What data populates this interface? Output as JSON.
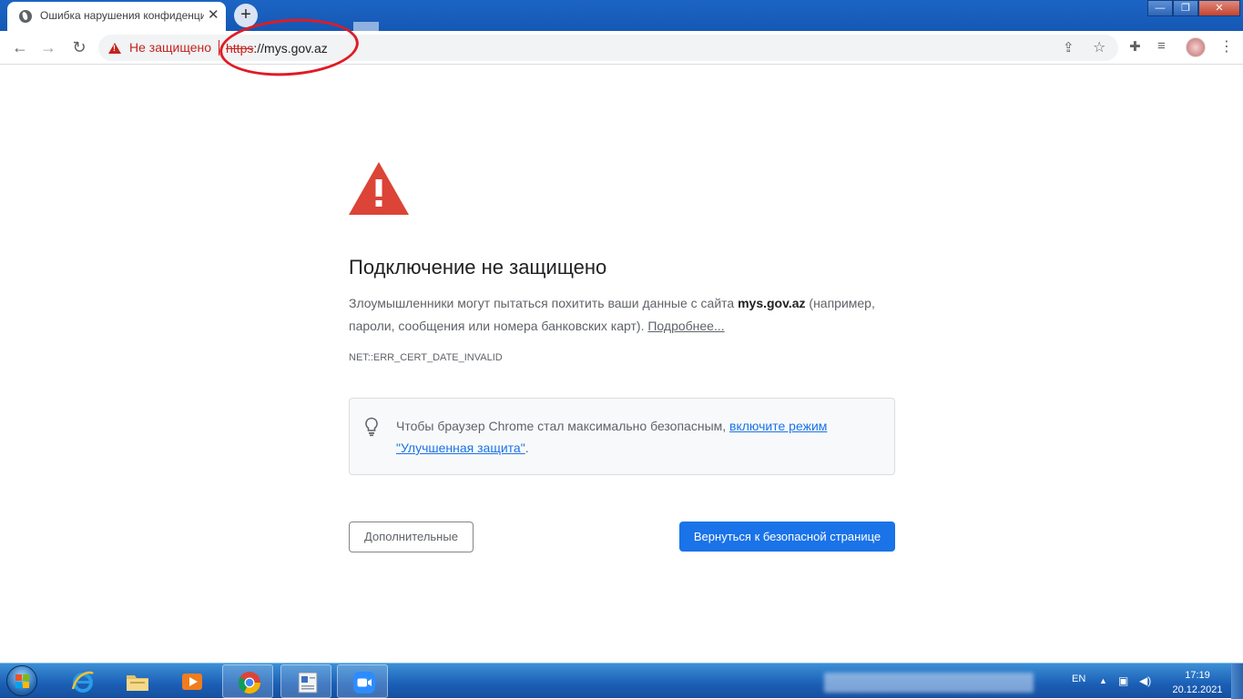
{
  "browser": {
    "tab_title": "Ошибка нарушения конфиденциальности",
    "tab_close": "✕",
    "new_tab": "+",
    "window_controls": {
      "minimize": "—",
      "restore": "❐",
      "close": "✕"
    },
    "toolbar": {
      "back": "←",
      "forward": "→",
      "reload": "↻",
      "security_label": "Не защищено",
      "url_scheme": "https",
      "url_rest": "://mys.gov.az",
      "share_icon": "⇪",
      "bookmark_icon": "☆",
      "extensions_icon": "✚",
      "media_icon": "≡",
      "menu_icon": "⋮"
    }
  },
  "page": {
    "heading": "Подключение не защищено",
    "para_before": "Злоумышленники могут пытаться похитить ваши данные с сайта ",
    "para_host": "mys.gov.az",
    "para_after": " (например, пароли, сообщения или номера банковских карт). ",
    "learn_more": "Подробнее...",
    "error_code": "NET::ERR_CERT_DATE_INVALID",
    "info_text": "Чтобы браузер Chrome стал максимально безопасным, ",
    "info_link": "включите режим \"Улучшенная защита\"",
    "info_end": ".",
    "advanced_button": "Дополнительные",
    "back_button": "Вернуться к безопасной странице"
  },
  "taskbar": {
    "language": "EN",
    "time": "17:19",
    "date": "20.12.2021",
    "apps": [
      "internet-explorer",
      "file-explorer",
      "media-player",
      "chrome",
      "text-editor",
      "zoom"
    ]
  },
  "colors": {
    "warning_red": "#c5221f",
    "accent_blue": "#1a73e8",
    "annotation_red": "#e01b24"
  }
}
